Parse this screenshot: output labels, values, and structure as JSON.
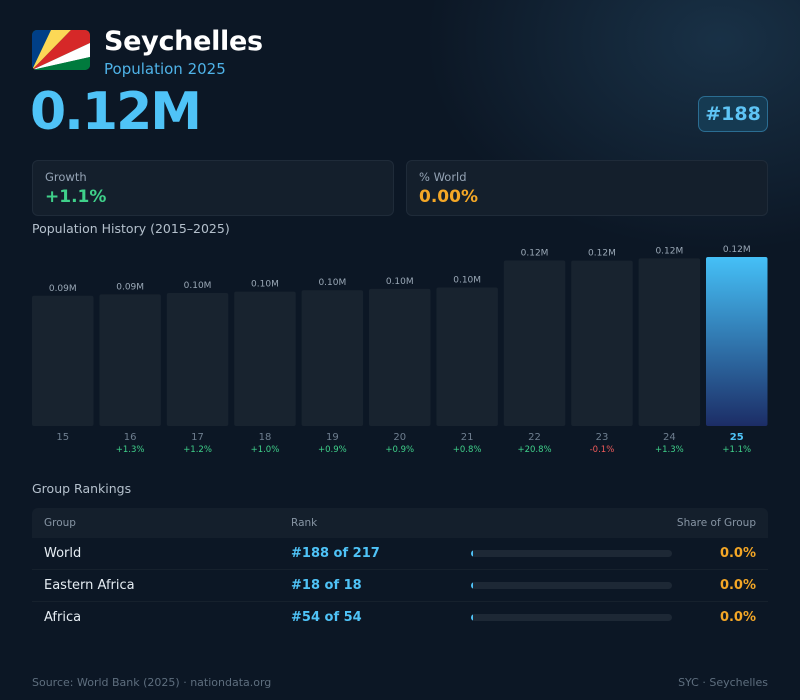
{
  "header": {
    "country": "Seychelles",
    "subtitle": "Population 2025",
    "population": "0.12M",
    "rank_badge": "#188",
    "flag_icon": "seychelles-flag-icon",
    "flag_colors": [
      "#003f87",
      "#fcd856",
      "#d62828",
      "#ffffff",
      "#007a3d"
    ]
  },
  "stats": {
    "growth": {
      "label": "Growth",
      "value": "+1.1%"
    },
    "world": {
      "label": "% World",
      "value": "0.00%"
    }
  },
  "history": {
    "title": "Population History (2015–2025)"
  },
  "chart_data": {
    "type": "bar",
    "title": "Population History (2015–2025)",
    "categories": [
      "15",
      "16",
      "17",
      "18",
      "19",
      "20",
      "21",
      "22",
      "23",
      "24",
      "25"
    ],
    "values": [
      0.094,
      0.095,
      0.096,
      0.097,
      0.098,
      0.099,
      0.1,
      0.1195,
      0.1194,
      0.121,
      0.122
    ],
    "value_labels": [
      "0.09M",
      "0.09M",
      "0.10M",
      "0.10M",
      "0.10M",
      "0.10M",
      "0.10M",
      "0.12M",
      "0.12M",
      "0.12M",
      "0.12M"
    ],
    "changes": [
      "",
      "+1.3%",
      "+1.2%",
      "+1.0%",
      "+0.9%",
      "+0.9%",
      "+0.8%",
      "+20.8%",
      "-0.1%",
      "+1.3%",
      "+1.1%"
    ],
    "highlight_index": 10,
    "colors": {
      "bar": "#18232f",
      "highlight_top": "#45c0f7",
      "highlight_bottom": "#1c2d66",
      "positive": "#3fd08a",
      "negative": "#ef5a5a"
    }
  },
  "rankings": {
    "title": "Group Rankings",
    "columns": {
      "group": "Group",
      "rank": "Rank",
      "share": "Share of Group"
    },
    "rows": [
      {
        "group": "World",
        "rank": "#188 of 217",
        "share": "0.0%",
        "share_fraction": 0.0
      },
      {
        "group": "Eastern Africa",
        "rank": "#18 of 18",
        "share": "0.0%",
        "share_fraction": 0.0
      },
      {
        "group": "Africa",
        "rank": "#54 of 54",
        "share": "0.0%",
        "share_fraction": 0.0
      }
    ]
  },
  "footer": {
    "source": "Source: World Bank (2025) · nationdata.org",
    "code": "SYC · Seychelles"
  }
}
